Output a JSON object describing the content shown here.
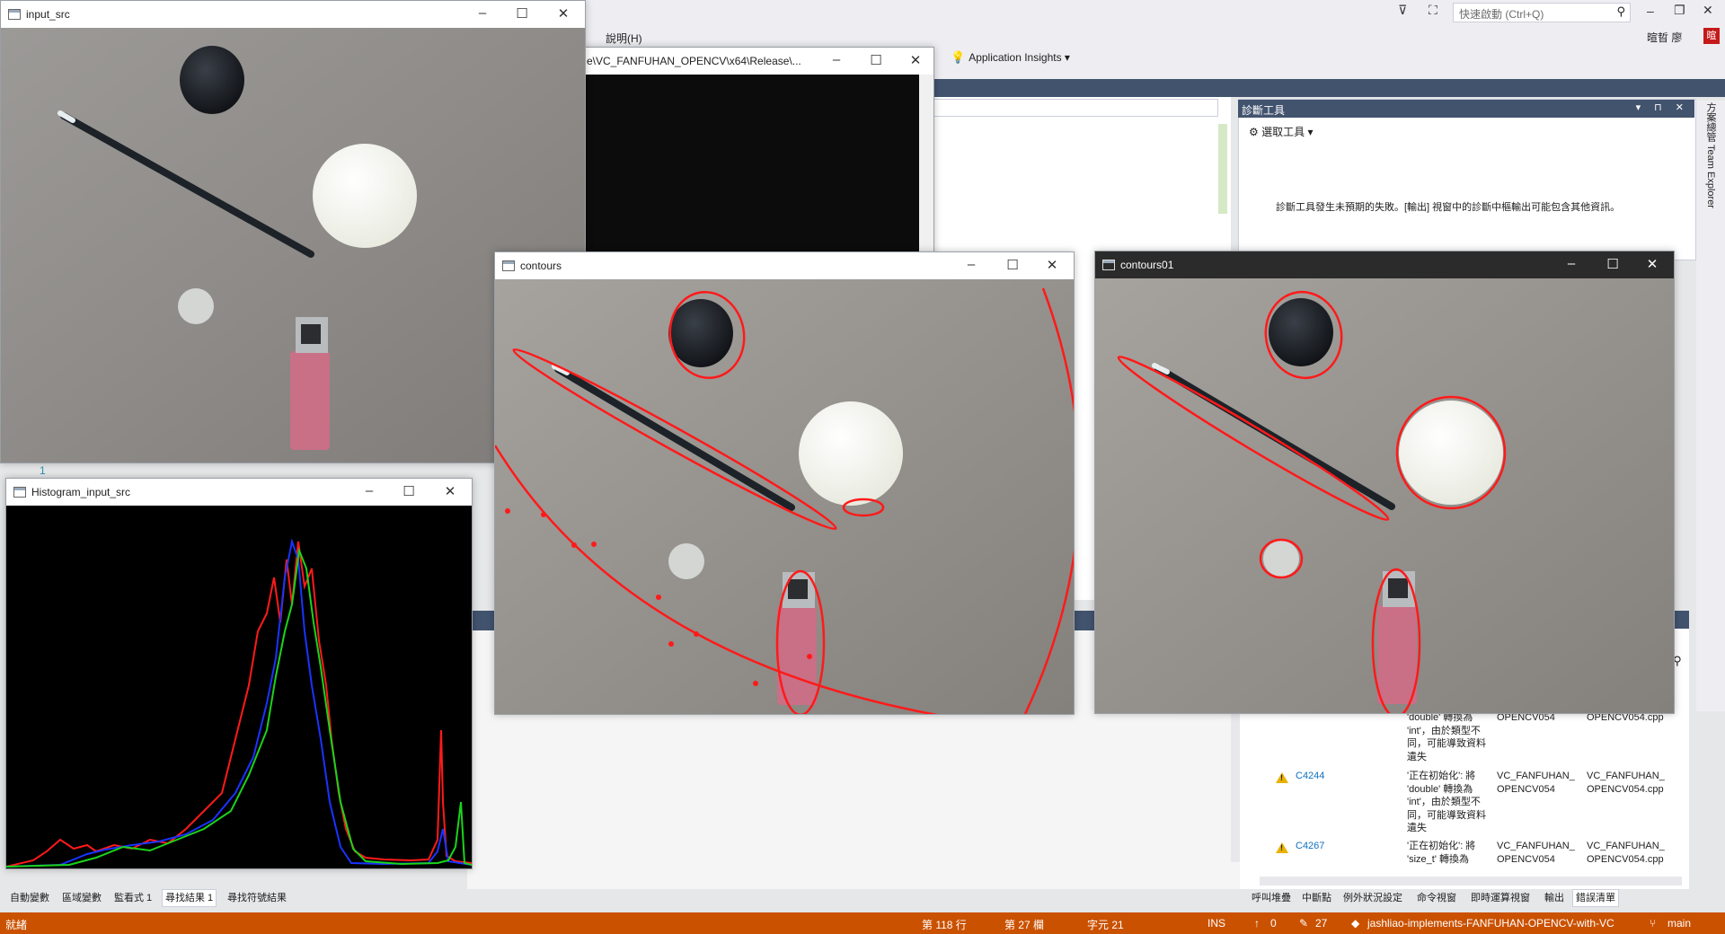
{
  "vs": {
    "help_menu": "說明(H)",
    "quick_launch_placeholder": "快速啟動 (Ctrl+Q)",
    "user_name": "暄晢 廖",
    "user_badge": "暄",
    "app_insights": "Application Insights",
    "console_path": "e\\VC_FANFUHAN_OPENCV\\x64\\Release\\...",
    "diag_title": "診斷工具",
    "diag_select": "選取工具",
    "diag_message": "診斷工具發生未預期的失敗。[輸出] 視窗中的診斷中樞輸出可能包含其他資訊。",
    "side_tab": "方案總管  Team Explorer",
    "editor_line_number": "1",
    "errors": [
      {
        "code": "",
        "desc": [
          "'double' 轉換為",
          "'int'，由於類型不",
          "同，可能導致資料",
          "遺失"
        ],
        "project": [
          "OPENCV054"
        ],
        "file": [
          "OPENCV054.cpp"
        ]
      },
      {
        "code": "C4244",
        "desc": [
          "'正在初始化': 將",
          "'double' 轉換為",
          "'int'，由於類型不",
          "同，可能導致資料",
          "遺失"
        ],
        "project": [
          "VC_FANFUHAN_",
          "OPENCV054"
        ],
        "file": [
          "VC_FANFUHAN_",
          "OPENCV054.cpp"
        ]
      },
      {
        "code": "C4267",
        "desc": [
          "'正在初始化': 將",
          "'size_t' 轉換為"
        ],
        "project": [
          "VC_FANFUHAN_",
          "OPENCV054"
        ],
        "file": [
          "VC_FANFUHAN_",
          "OPENCV054.cpp"
        ]
      }
    ],
    "bottom_tabs_left": [
      "自動變數",
      "區域變數",
      "監看式 1",
      "尋找結果 1",
      "尋找符號結果"
    ],
    "bottom_tabs_right": [
      "呼叫堆疊",
      "中斷點",
      "例外狀況設定",
      "命令視窗",
      "即時運算視窗",
      "輸出",
      "錯誤清單"
    ],
    "status": {
      "ready": "就緒",
      "line": "第 118 行",
      "col": "第 27 欄",
      "char": "字元 21",
      "mode": "INS",
      "up": "0",
      "pencil": "27",
      "repo": "jashliao-implements-FANFUHAN-OPENCV-with-VC",
      "branch": "main"
    },
    "colors": {
      "accent": "#42536e",
      "statusbar": "#ca5100",
      "contour": "#ff1a1a"
    }
  },
  "windows": {
    "input_src": {
      "title": "input_src"
    },
    "histogram": {
      "title": "Histogram_input_src"
    },
    "contours": {
      "title": "contours"
    },
    "contours01": {
      "title": "contours01"
    }
  },
  "icons": [
    "filter-icon",
    "person-icon",
    "search-icon",
    "minimize-icon",
    "maximize-icon",
    "close-icon",
    "lightbulb-icon",
    "gear-icon",
    "warning-icon",
    "git-branch-icon",
    "pencil-icon",
    "up-arrow-icon"
  ]
}
